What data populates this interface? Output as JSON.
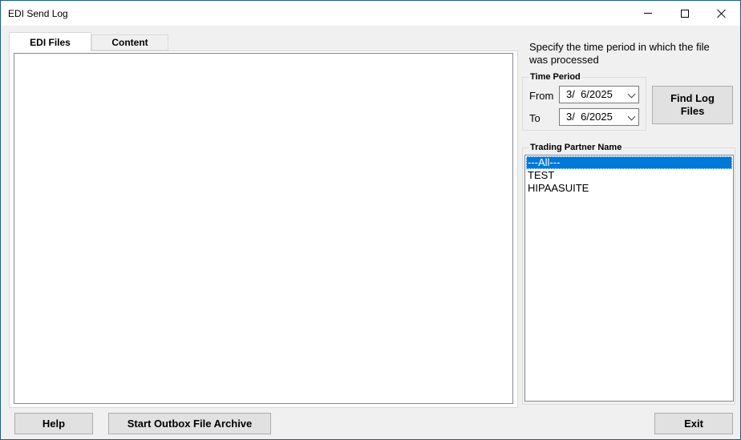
{
  "window": {
    "title": "EDI Send Log",
    "minimize_glyph": "minimize-icon",
    "maximize_glyph": "maximize-icon",
    "close_glyph": "close-icon"
  },
  "tabs": [
    {
      "label": "EDI Files",
      "active": true
    },
    {
      "label": "Content",
      "active": false
    }
  ],
  "instruction": "Specify the time period in which the file was processed",
  "time_period": {
    "legend": "Time Period",
    "from_label": "From",
    "to_label": "To",
    "from_value": "3/  6/2025",
    "to_value": "3/  6/2025"
  },
  "find_button": "Find Log Files",
  "trading_partner": {
    "legend": "Trading Partner Name",
    "items": [
      "---All---",
      "TEST",
      "HIPAASUITE"
    ],
    "selected_index": 0
  },
  "footer": {
    "help": "Help",
    "archive": "Start Outbox File Archive",
    "exit": "Exit"
  },
  "colors": {
    "selection": "#0078d7",
    "window_border": "#1e5d8c"
  }
}
